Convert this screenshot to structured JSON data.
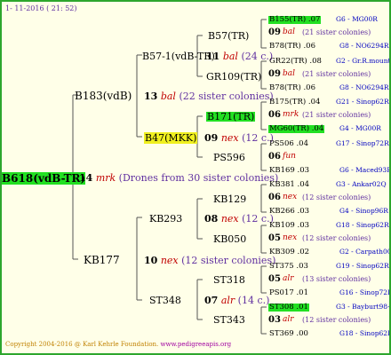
{
  "header": {
    "date": "1- 11-2016 ( 21: 52)"
  },
  "footer": {
    "copyright": "Copyright 2004-2016 @ Karl Kehrle Foundation.",
    "url": "www.pedigreeapis.org"
  },
  "root": {
    "code": "B618(vdB-TR)",
    "year": "14",
    "mark": "mrk",
    "note": "(Drones from 30 sister colonies)"
  },
  "gen1": {
    "upper": {
      "code": "B183(vdB)"
    },
    "lower": {
      "code": "KB177"
    }
  },
  "gen1_upper_mating": {
    "year": "13",
    "mark": "bal",
    "note": "(22 sister colonies)"
  },
  "gen1_lower_mating": {
    "year": "10",
    "mark": "nex",
    "note": "(12 sister colonies)"
  },
  "gen2": {
    "a": {
      "code": "B57-1(vdB-TR)",
      "year": "11",
      "mark": "bal",
      "note": "(24 c.)"
    },
    "b": {
      "code": "B47(MKK)",
      "year": "09",
      "mark": "nex",
      "note": "(12 c.)"
    },
    "c": {
      "code": "KB293",
      "year": "08",
      "mark": "nex",
      "note": "(12 c.)"
    },
    "d": {
      "code": "ST348",
      "year": "07",
      "mark": "alr",
      "note": "(14 c.)"
    }
  },
  "gen3": [
    {
      "code": "B57(TR)"
    },
    {
      "code": "GR109(TR)"
    },
    {
      "code": "B171(TR)"
    },
    {
      "code": "PS596"
    },
    {
      "code": "KB129"
    },
    {
      "code": "KB050"
    },
    {
      "code": "ST318"
    },
    {
      "code": "ST343"
    }
  ],
  "gen4": [
    {
      "queen": "B155(TR) .07",
      "loc": "G6 - MG00R",
      "year": "09",
      "mark": "bal",
      "note": "(21 sister colonies)",
      "father": "B78(TR) .06",
      "floc": "G8 - NO6294R"
    },
    {
      "queen": "GR22(TR) .08",
      "loc": "G2 - Gr.R.mounta",
      "year": "09",
      "mark": "bal",
      "note": "(21 sister colonies)",
      "father": "B78(TR) .06",
      "floc": "G8 - NO6294R"
    },
    {
      "queen": "B175(TR) .04",
      "loc": "G21 - Sinop62R",
      "year": "06",
      "mark": "mrk",
      "note": "(21 sister colonies)",
      "father": "MG60(TR) .04",
      "floc": "G4 - MG00R"
    },
    {
      "queen": "PS506 .04",
      "loc": "G17 - Sinop72R",
      "year": "06",
      "mark": "fun",
      "note": "",
      "father": "KB169 .03",
      "floc": "G6 - Maced93R"
    },
    {
      "queen": "KB381 .04",
      "loc": "G3 - Ankar02Q",
      "year": "06",
      "mark": "nex",
      "note": "(12 sister colonies)",
      "father": "KB266 .03",
      "floc": "G4 - Sinop96R"
    },
    {
      "queen": "KB109 .03",
      "loc": "G18 - Sinop62R",
      "year": "05",
      "mark": "nex",
      "note": "(12 sister colonies)",
      "father": "KB309 .02",
      "floc": "G2 - Carpath00R"
    },
    {
      "queen": "ST375 .03",
      "loc": "G19 - Sinop62R",
      "year": "05",
      "mark": "alr",
      "note": "(13 sister colonies)",
      "father": "PS017 .01",
      "floc": "G16 - Sinop72R"
    },
    {
      "queen": "ST308 .01",
      "loc": "G3 - Bayburt98-3",
      "year": "03",
      "mark": "alr",
      "note": "(12 sister colonies)",
      "father": "ST369 .00",
      "floc": "G18 - Sinop62R"
    }
  ]
}
